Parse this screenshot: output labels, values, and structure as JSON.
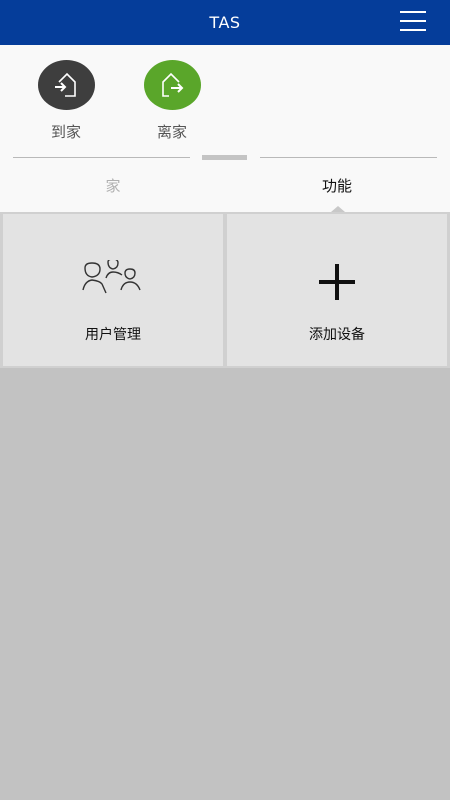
{
  "header": {
    "title": "TAS",
    "menu_icon": "hamburger-menu-icon"
  },
  "modes": [
    {
      "label": "到家",
      "icon": "arrive-home-icon",
      "color": "#3e3e3e"
    },
    {
      "label": "离家",
      "icon": "leave-home-icon",
      "color": "#5aa62a"
    }
  ],
  "tabs": [
    {
      "label": "家",
      "active": false
    },
    {
      "label": "功能",
      "active": true
    }
  ],
  "tiles": [
    {
      "label": "用户管理",
      "icon": "users-icon"
    },
    {
      "label": "添加设备",
      "icon": "plus-icon"
    }
  ],
  "colors": {
    "header_bg": "#053d9a",
    "page_bg": "#c2c2c2",
    "tile_bg": "#e3e3e3"
  }
}
